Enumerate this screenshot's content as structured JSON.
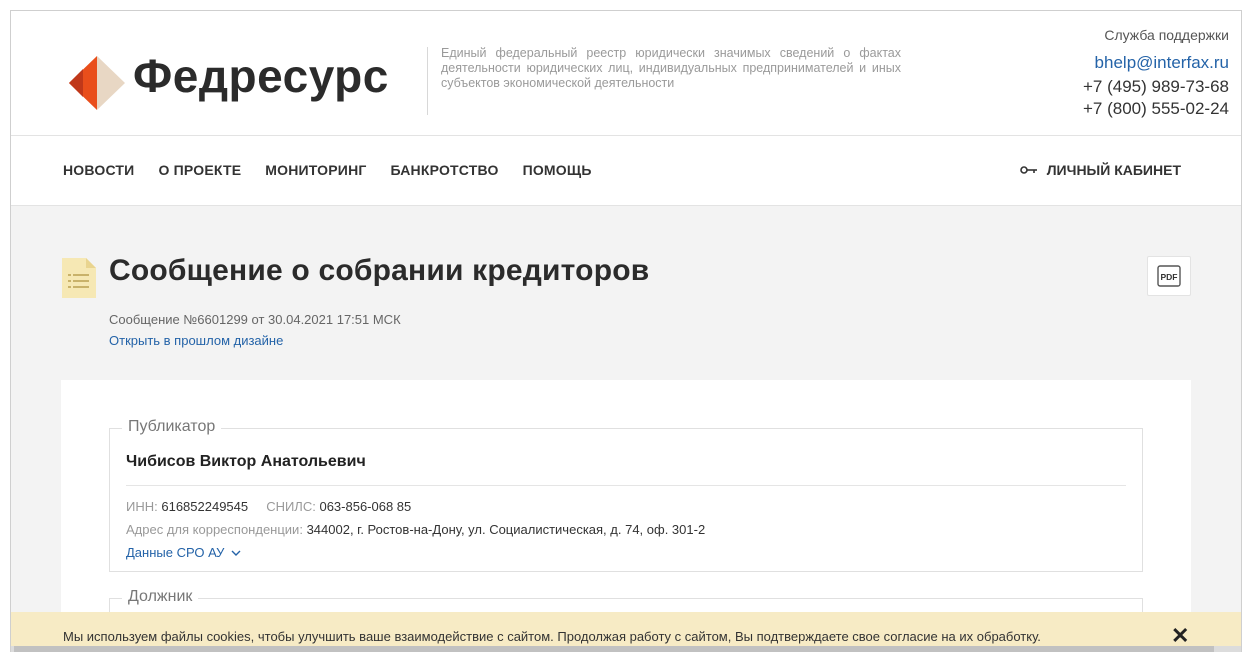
{
  "header": {
    "logo_text": "Федресурс",
    "tagline": "Единый федеральный реестр юридически значимых сведений о фактах деятельности юридических лиц, индивидуальных предпринимателей и иных субъектов экономической деятельности",
    "support_label": "Служба поддержки",
    "support_email": "bhelp@interfax.ru",
    "support_phone_1": "+7 (495) 989-73-68",
    "support_phone_2": "+7 (800) 555-02-24",
    "logo_colors": [
      "#e94e1b",
      "#c0381a",
      "#e8d7c4"
    ]
  },
  "nav": {
    "items": [
      {
        "label": "НОВОСТИ"
      },
      {
        "label": "О ПРОЕКТЕ"
      },
      {
        "label": "МОНИТОРИНГ"
      },
      {
        "label": "БАНКРОТСТВО"
      },
      {
        "label": "ПОМОЩЬ"
      }
    ],
    "cabinet_label": "ЛИЧНЫЙ КАБИНЕТ",
    "cabinet_icon": "key-icon"
  },
  "message": {
    "title": "Сообщение о собрании кредиторов",
    "meta": "Сообщение №6601299 от 30.04.2021 17:51 МСК",
    "old_design_link": "Открыть в прошлом дизайне",
    "pdf_label": "PDF"
  },
  "publisher": {
    "legend": "Публикатор",
    "name": "Чибисов Виктор Анатольевич",
    "inn_label": "ИНН:",
    "inn_value": "616852249545",
    "snils_label": "СНИЛС:",
    "snils_value": "063-856-068 85",
    "address_label": "Адрес для корреспонденции:",
    "address_value": "344002, г. Ростов-на-Дону, ул. Социалистическая, д. 74, оф. 301-2",
    "sro_link": "Данные СРО АУ"
  },
  "debtor": {
    "legend": "Должник"
  },
  "cookie": {
    "text": "Мы используем файлы cookies, чтобы улучшить ваше взаимодействие с сайтом. Продолжая работу с сайтом, Вы подтверждаете свое согласие на их обработку.",
    "close": "✕"
  },
  "colors": {
    "link": "#2463a8",
    "cookie_bg": "#f7ebc5",
    "page_bg": "#f3f3f3"
  }
}
